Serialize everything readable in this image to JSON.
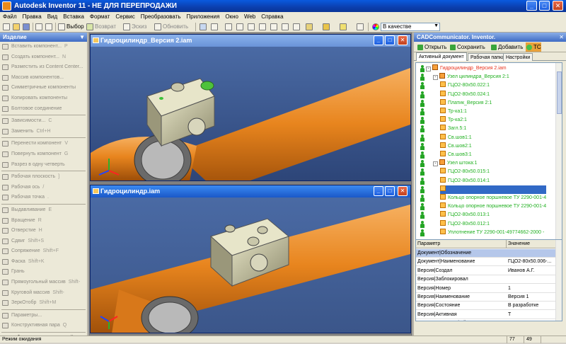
{
  "window": {
    "title": "Autodesk Inventor 11 - НЕ ДЛЯ ПЕРЕПРОДАЖИ"
  },
  "menu": [
    "Файл",
    "Правка",
    "Вид",
    "Вставка",
    "Формат",
    "Сервис",
    "Преобразовать",
    "Приложения",
    "Окно",
    "Web",
    "Справка"
  ],
  "toolbar": {
    "select_label": "Выбор",
    "return_label": "Возврат",
    "sketch_label": "Эскиз",
    "update_label": "Обновить",
    "material_label": "В качестве материала"
  },
  "left_panel": {
    "title": "Изделие",
    "items": [
      {
        "label": "Вставить компонент...",
        "shortcut": "P",
        "enabled": false
      },
      {
        "label": "Создать компонент...",
        "shortcut": "N",
        "enabled": false
      },
      {
        "label": "Разместить из Content Center...",
        "shortcut": "",
        "enabled": false
      },
      {
        "label": "Массив компонентов...",
        "shortcut": "",
        "enabled": false
      },
      {
        "label": "Симметричные компоненты",
        "shortcut": "",
        "enabled": false
      },
      {
        "label": "Копировать компоненты",
        "shortcut": "",
        "enabled": false
      },
      {
        "label": "Болтовое соединение",
        "shortcut": "",
        "enabled": false
      },
      {
        "label": "Зависимости...",
        "shortcut": "C",
        "enabled": false
      },
      {
        "label": "Заменить",
        "shortcut": "Ctrl+H",
        "enabled": false
      },
      {
        "label": "Перенести компонент",
        "shortcut": "V",
        "enabled": false
      },
      {
        "label": "Повернуть компонент",
        "shortcut": "G",
        "enabled": false
      },
      {
        "label": "Разрез в одну четверть",
        "shortcut": "",
        "enabled": false
      },
      {
        "label": "Рабочая плоскость",
        "shortcut": "]",
        "enabled": false
      },
      {
        "label": "Рабочая ось",
        "shortcut": "/",
        "enabled": false
      },
      {
        "label": "Рабочая точка",
        "shortcut": ".",
        "enabled": false
      },
      {
        "label": "Выдавливание",
        "shortcut": "E",
        "enabled": false
      },
      {
        "label": "Вращение",
        "shortcut": "R",
        "enabled": false
      },
      {
        "label": "Отверстие",
        "shortcut": "H",
        "enabled": false
      },
      {
        "label": "Сдвиг",
        "shortcut": "Shift+S",
        "enabled": false
      },
      {
        "label": "Сопряжение",
        "shortcut": "Shift+F",
        "enabled": false
      },
      {
        "label": "Фаска",
        "shortcut": "Shift+K",
        "enabled": false
      },
      {
        "label": "Грань",
        "shortcut": "",
        "enabled": false
      },
      {
        "label": "Прямоугольный массив",
        "shortcut": "Shift-",
        "enabled": false
      },
      {
        "label": "Круговой массив",
        "shortcut": "Shift-",
        "enabled": false
      },
      {
        "label": "ЗеркОтобр",
        "shortcut": "Shift+M",
        "enabled": false
      },
      {
        "label": "Параметры...",
        "shortcut": "",
        "enabled": false
      },
      {
        "label": "Конструктивная пара",
        "shortcut": "Q",
        "enabled": false
      },
      {
        "label": "Таблица составных частей...",
        "shortcut": "",
        "enabled": true
      }
    ]
  },
  "mdi": {
    "win1_title": "Гидроцилиндр_Версия 2.iam",
    "win2_title": "Гидроцилиндр.iam"
  },
  "right_panel": {
    "title": "CADCommunicator. Inventor.",
    "buttons": {
      "open": "Открыть",
      "save": "Сохранить",
      "add": "Добавить",
      "tc": "TC"
    },
    "tabs": [
      "Активный документ",
      "Рабочая папка",
      "Настройки"
    ],
    "tree": [
      {
        "label": "Гидроцилиндр_Версия 2.iam",
        "level": 0,
        "type": "asm",
        "pm": "-",
        "red": true
      },
      {
        "label": "Узел цилиндра_Версия 2:1",
        "level": 1,
        "type": "asm",
        "pm": "-",
        "red": false
      },
      {
        "label": "ГЦО2-80х50.022:1",
        "level": 2,
        "type": "part",
        "pm": "",
        "red": false
      },
      {
        "label": "ГЦО2-80х50.024:1",
        "level": 2,
        "type": "part",
        "pm": "",
        "red": false
      },
      {
        "label": "Платик_Версия 2:1",
        "level": 2,
        "type": "part",
        "pm": "",
        "red": false
      },
      {
        "label": "Тр-ка1:1",
        "level": 2,
        "type": "part",
        "pm": "",
        "red": false
      },
      {
        "label": "Тр-ка2:1",
        "level": 2,
        "type": "part",
        "pm": "",
        "red": false
      },
      {
        "label": "Загл.5:1",
        "level": 2,
        "type": "part",
        "pm": "",
        "red": false
      },
      {
        "label": "Св.шов1:1",
        "level": 2,
        "type": "part",
        "pm": "",
        "red": false
      },
      {
        "label": "Св.шов2:1",
        "level": 2,
        "type": "part",
        "pm": "",
        "red": false
      },
      {
        "label": "Св.шов3:1",
        "level": 2,
        "type": "part",
        "pm": "",
        "red": false
      },
      {
        "label": "Узел штока:1",
        "level": 1,
        "type": "asm",
        "pm": "-",
        "red": false
      },
      {
        "label": "ГЦО2-80х50.015:1",
        "level": 2,
        "type": "part",
        "pm": "",
        "red": false
      },
      {
        "label": "ГЦО2-80х50.014:1",
        "level": 2,
        "type": "part",
        "pm": "",
        "red": false
      },
      {
        "label": "",
        "level": 2,
        "type": "part",
        "pm": "",
        "red": false,
        "selected": true
      },
      {
        "label": "Кольцо опорное поршневое ТУ 2290-001-4",
        "level": 2,
        "type": "part",
        "pm": "",
        "red": false
      },
      {
        "label": "Кольцо опорное поршневое ТУ 2290-001-4",
        "level": 2,
        "type": "part",
        "pm": "",
        "red": false
      },
      {
        "label": "ГЦО2-80х50.013:1",
        "level": 2,
        "type": "part",
        "pm": "",
        "red": false
      },
      {
        "label": "ГЦО2-80х50.012:1",
        "level": 2,
        "type": "part",
        "pm": "",
        "red": false
      },
      {
        "label": "Уплотнение ТУ 2290-001-49774662-2000 -",
        "level": 2,
        "type": "part",
        "pm": "",
        "red": false
      }
    ],
    "grid": {
      "headers": [
        "Параметр",
        "Значение"
      ],
      "rows": [
        {
          "param": "Документ|Обозначение",
          "value": "",
          "selected": true
        },
        {
          "param": "Документ|Наименование",
          "value": "ГЦО2-80х50.006-..."
        },
        {
          "param": "Версия|Создал",
          "value": "Иванов А.Г."
        },
        {
          "param": "Версия|Заблокировал",
          "value": ""
        },
        {
          "param": "Версия|Номер",
          "value": "1"
        },
        {
          "param": "Версия|Наименование",
          "value": "Версия 1"
        },
        {
          "param": "Версия|Состояние",
          "value": "В разработке"
        },
        {
          "param": "Версия|Активная",
          "value": "T"
        },
        {
          "param": "Редактирование файлового состава",
          "value": "T"
        }
      ]
    }
  },
  "status": {
    "text": "Режим ожидания",
    "n1": "77",
    "n2": "49"
  },
  "colors": {
    "viewport_bg": "#3f5c92",
    "cylinder": "#e8851e",
    "block": "#c9c6a7",
    "tree_green": "#20b020"
  }
}
